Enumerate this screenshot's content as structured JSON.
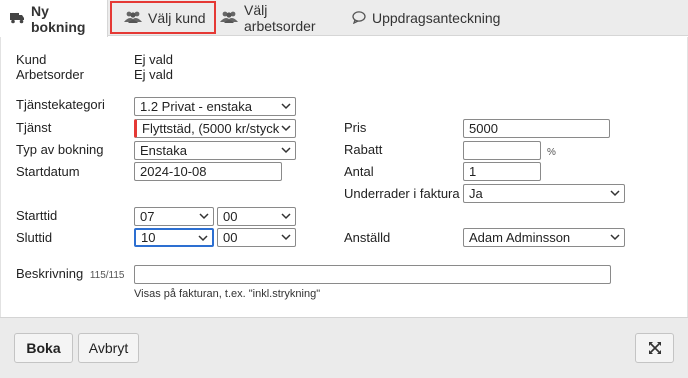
{
  "tabs": [
    {
      "label": "Ny bokning",
      "icon": "truck-icon"
    },
    {
      "label": "Välj kund",
      "icon": "users-icon"
    },
    {
      "label": "Välj arbetsorder",
      "icon": "users-icon"
    },
    {
      "label": "Uppdragsanteckning",
      "icon": "speech-bubble-icon"
    }
  ],
  "customer": {
    "label": "Kund",
    "value": "Ej vald"
  },
  "workorder": {
    "label": "Arbetsorder",
    "value": "Ej vald"
  },
  "service_category": {
    "label": "Tjänstekategori",
    "value": "1.2 Privat - enstaka"
  },
  "service": {
    "label": "Tjänst",
    "value": "Flyttstäd, (5000 kr/styck"
  },
  "booking_type": {
    "label": "Typ av bokning",
    "value": "Enstaka"
  },
  "start_date": {
    "label": "Startdatum",
    "value": "2024-10-08"
  },
  "start_time": {
    "label": "Starttid",
    "hour": "07",
    "minute": "00"
  },
  "end_time": {
    "label": "Sluttid",
    "hour": "10",
    "minute": "00"
  },
  "price": {
    "label": "Pris",
    "value": "5000"
  },
  "discount": {
    "label": "Rabatt",
    "value": "",
    "unit": "%"
  },
  "quantity": {
    "label": "Antal",
    "value": "1"
  },
  "subrows": {
    "label": "Underrader i faktura",
    "value": "Ja"
  },
  "employee": {
    "label": "Anställd",
    "value": "Adam Adminsson"
  },
  "description": {
    "label": "Beskrivning",
    "counter": "115/115",
    "value": "",
    "hint": "Visas på fakturan, t.ex. \"inkl.strykning\""
  },
  "footer": {
    "book_label": "Boka",
    "cancel_label": "Avbryt",
    "expand_icon": "expand-icon"
  },
  "colors": {
    "highlight": "#e53935",
    "focus": "#2d6fd1"
  }
}
